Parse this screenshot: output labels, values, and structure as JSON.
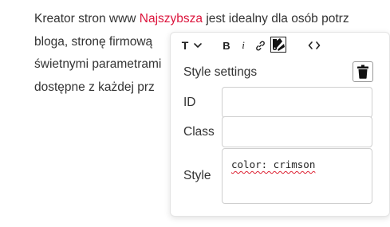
{
  "paragraph": {
    "line1_before": "Kreator stron www ",
    "line1_highlight": "Najszybsza",
    "line1_after": " jest idealny dla osób potrz",
    "line2": "bloga, stronę firmową",
    "line3": "świetnymi parametrami",
    "line4": "dostępne z każdej prz"
  },
  "toolbar": {
    "text_style_icon": "T",
    "bold_label": "B",
    "italic_label": "i",
    "link_icon": "link-icon",
    "palette_icon": "color-palette-icon",
    "code_icon": "code-icon"
  },
  "style_settings": {
    "title": "Style settings",
    "delete_icon": "trash-icon",
    "fields": {
      "id_label": "ID",
      "id_value": "",
      "class_label": "Class",
      "class_value": "",
      "style_label": "Style",
      "style_value": "color: crimson"
    }
  },
  "colors": {
    "highlight": "crimson",
    "text": "#333333"
  }
}
